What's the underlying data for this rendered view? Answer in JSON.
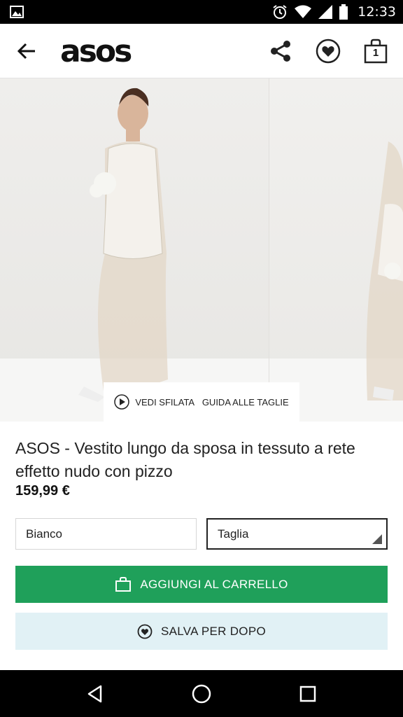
{
  "status_bar": {
    "time": "12:33",
    "icons": [
      "image-icon",
      "alarm-icon",
      "wifi-icon",
      "signal-icon",
      "battery-icon"
    ]
  },
  "app_bar": {
    "logo": "asos",
    "bag_count": "1",
    "icons": [
      "back-arrow-icon",
      "share-icon",
      "heart-icon",
      "shopping-bag-icon"
    ]
  },
  "gallery": {
    "watch_label": "VEDI SFILATA",
    "size_guide_label": "GUIDA ALLE TAGLIE"
  },
  "product": {
    "title": "ASOS - Vestito lungo da sposa in tessuto a rete effetto nudo con pizzo",
    "price": "159,99 €"
  },
  "selectors": {
    "colour": "Bianco",
    "size": "Taglia"
  },
  "buttons": {
    "add_to_bag": "AGGIUNGI AL CARRELLO",
    "save_for_later": "SALVA PER DOPO"
  },
  "colors": {
    "primary_green": "#1fa05a",
    "save_bg": "#e1f1f5"
  }
}
